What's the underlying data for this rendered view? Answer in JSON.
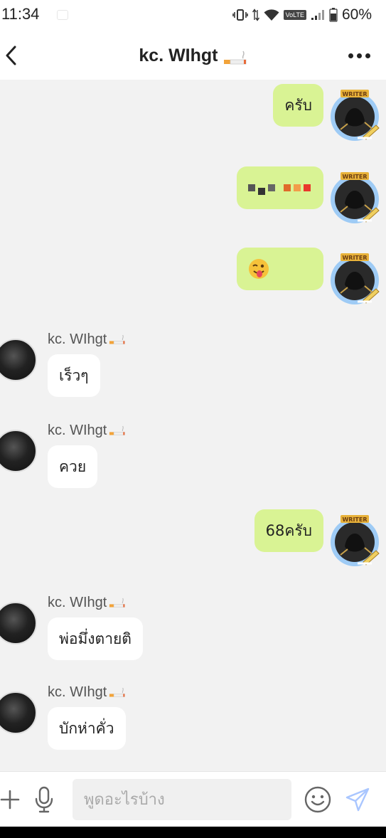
{
  "status_bar": {
    "time": "11:34",
    "network": "VoLTE",
    "battery": "60%"
  },
  "header": {
    "title": "kc. WIhgt"
  },
  "messages": [
    {
      "direction": "out",
      "text": "ครับ"
    },
    {
      "direction": "out",
      "text": ""
    },
    {
      "direction": "out",
      "text": "😜"
    },
    {
      "direction": "in",
      "sender": "kc. WIhgt",
      "text": "เร็วๆ"
    },
    {
      "direction": "in",
      "sender": "kc. WIhgt",
      "text": "ควย"
    },
    {
      "direction": "out",
      "text": "68ครับ"
    },
    {
      "direction": "in",
      "sender": "kc. WIhgt",
      "text": "พ่อมึ่งตายติ"
    },
    {
      "direction": "in",
      "sender": "kc. WIhgt",
      "text": "บักห่าคั่ว"
    }
  ],
  "avatar_badge": "WRITER",
  "input": {
    "placeholder": "พูดอะไรบ้าง",
    "value": ""
  },
  "colors": {
    "outgoing_bubble": "#d9f394",
    "incoming_bubble": "#ffffff",
    "chat_background": "#f2f2f2",
    "send_icon": "#a9c6ff"
  }
}
